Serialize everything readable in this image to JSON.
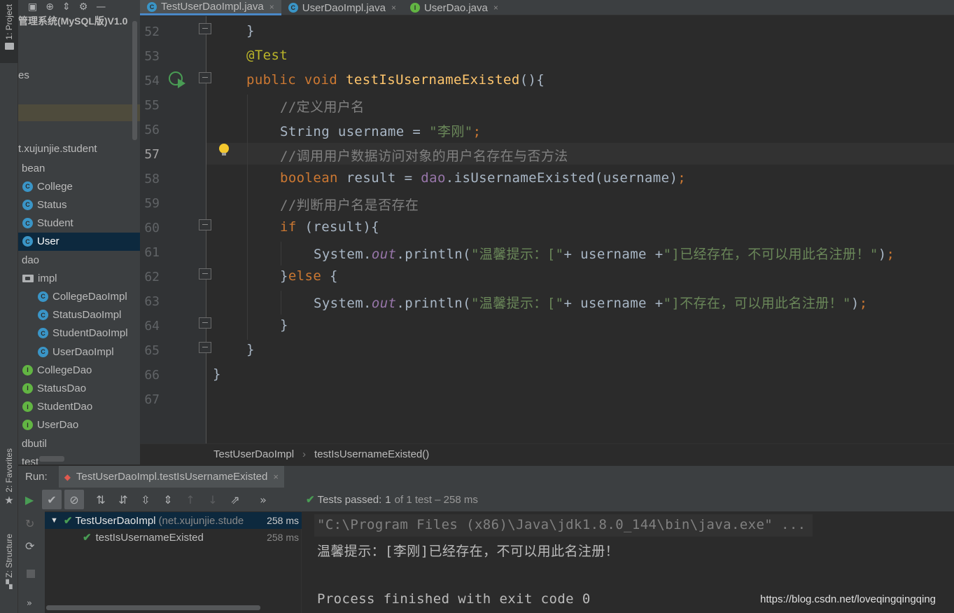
{
  "left_strip": {
    "project_tab": "1: Project",
    "favorites_tab": "2: Favorites",
    "structure_tab": "Z: Structure"
  },
  "project": {
    "title": "管理系统(MySQL版)V1.0",
    "partial_es": "es",
    "package": "t.xujunjie.student",
    "tree": [
      {
        "label": "bean",
        "icon": "none",
        "indent": 5
      },
      {
        "label": "College",
        "icon": "class",
        "indent": 6
      },
      {
        "label": "Status",
        "icon": "class",
        "indent": 6
      },
      {
        "label": "Student",
        "icon": "class",
        "indent": 6
      },
      {
        "label": "User",
        "icon": "class",
        "indent": 6,
        "selected": true
      },
      {
        "label": "dao",
        "icon": "none",
        "indent": 5
      },
      {
        "label": "impl",
        "icon": "folder",
        "indent": 6
      },
      {
        "label": "CollegeDaoImpl",
        "icon": "class",
        "indent": 28
      },
      {
        "label": "StatusDaoImpl",
        "icon": "class",
        "indent": 28
      },
      {
        "label": "StudentDaoImpl",
        "icon": "class",
        "indent": 28
      },
      {
        "label": "UserDaoImpl",
        "icon": "class",
        "indent": 28
      },
      {
        "label": "CollegeDao",
        "icon": "interface",
        "indent": 6
      },
      {
        "label": "StatusDao",
        "icon": "interface",
        "indent": 6
      },
      {
        "label": "StudentDao",
        "icon": "interface",
        "indent": 6
      },
      {
        "label": "UserDao",
        "icon": "interface",
        "indent": 6
      },
      {
        "label": "dbutil",
        "icon": "none",
        "indent": 5
      },
      {
        "label": "test",
        "icon": "none",
        "indent": 5
      }
    ]
  },
  "tabs": [
    {
      "label": "TestUserDaoImpl.java",
      "icon": "class",
      "active": true,
      "close": "×"
    },
    {
      "label": "UserDaoImpl.java",
      "icon": "class",
      "active": false,
      "close": "×"
    },
    {
      "label": "UserDao.java",
      "icon": "interface",
      "active": false,
      "close": "×"
    }
  ],
  "editor": {
    "line_numbers": [
      "52",
      "53",
      "54",
      "55",
      "56",
      "57",
      "58",
      "59",
      "60",
      "61",
      "62",
      "63",
      "64",
      "65",
      "66",
      "67"
    ],
    "lines": {
      "l52": "}",
      "l53": "@Test",
      "l54_kw": "public void ",
      "l54_fn": "testIsUsernameExisted",
      "l54_rest": "(){",
      "l55": "//定义用户名",
      "l56_a": "String username = ",
      "l56_str": "\"李刚\"",
      "l56_semi": ";",
      "l57": "//调用用户数据访问对象的用户名存在与否方法",
      "l58_kw": "boolean",
      "l58_a": " result = ",
      "l58_fld": "dao",
      "l58_b": ".isUsernameExisted(username)",
      "l58_semi": ";",
      "l59": "//判断用户名是否存在",
      "l60_kw": "if",
      "l60_rest": " (result){",
      "l61_a": "System.",
      "l61_out": "out",
      "l61_b": ".println(",
      "l61_s1": "\"温馨提示：[\"",
      "l61_c": "+ username +",
      "l61_s2": "\"]已经存在，不可以用此名注册！\"",
      "l61_d": ")",
      "l61_semi": ";",
      "l62_a": "}",
      "l62_kw": "else",
      "l62_b": " {",
      "l63_a": "System.",
      "l63_out": "out",
      "l63_b": ".println(",
      "l63_s1": "\"温馨提示：[\"",
      "l63_c": "+ username +",
      "l63_s2": "\"]不存在，可以用此名注册！\"",
      "l63_d": ")",
      "l63_semi": ";",
      "l64": "}",
      "l65": "}",
      "l66": "}"
    }
  },
  "breadcrumb": {
    "class_name": "TestUserDaoImpl",
    "separator": "›",
    "method_name": "testIsUsernameExisted()"
  },
  "run": {
    "label": "Run:",
    "config_name": "TestUserDaoImpl.testIsUsernameExisted",
    "close": "×",
    "status_prefix": "Tests passed:",
    "status_count": "1",
    "status_of": "of 1 test – 258 ms",
    "more": "»",
    "tree": [
      {
        "label": "TestUserDaoImpl",
        "sub": "(net.xujunjie.stude",
        "time": "258 ms"
      },
      {
        "label": "testIsUsernameExisted",
        "time": "258 ms"
      }
    ],
    "console": {
      "cmd": "\"C:\\Program Files (x86)\\Java\\jdk1.8.0_144\\bin\\java.exe\" ...",
      "output": "温馨提示：[李刚]已经存在，不可以用此名注册！",
      "exit": "Process finished with exit code 0"
    }
  },
  "watermark": "https://blog.csdn.net/loveqingqingqing",
  "colors": {
    "keyword": "#cc7832",
    "annotation": "#bbb529",
    "method": "#ffc66d",
    "comment": "#808080",
    "string": "#6a8759",
    "field": "#9876aa",
    "pass_green": "#499c54",
    "selection": "#0d293e"
  }
}
